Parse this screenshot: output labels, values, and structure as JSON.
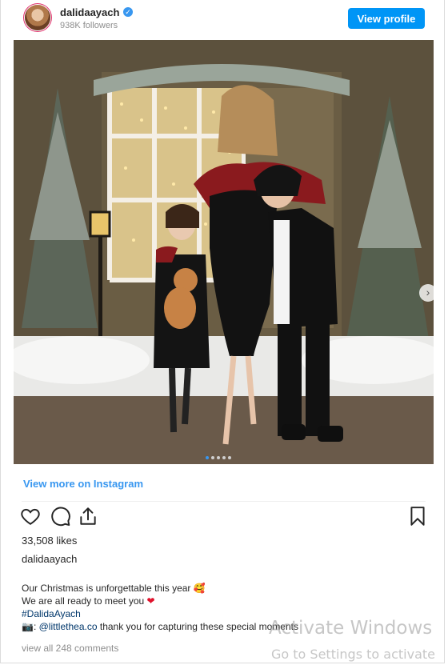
{
  "post": {
    "username": "dalidaayach",
    "verified_mark": "✓",
    "followers": "938K followers",
    "view_profile": "View profile",
    "view_more": "View more on Instagram",
    "likes": "33,508 likes",
    "owner": "dalidaayach",
    "caption": {
      "line1": "Our Christmas is unforgettable this year",
      "line1_emoji": "🥰",
      "line2": "We are all ready to meet you",
      "line2_emoji": "❤",
      "hashtag": "#DalidaAyach",
      "line4_icon": "📷:",
      "mention": "@littlethea.co",
      "line4_text": "thank you for capturing these special moments"
    },
    "comments_link": "view all 248 comments",
    "carousel_next": "›",
    "photo_subject": "family-christmas-photo"
  },
  "watermark": {
    "line1": "Activate Windows",
    "line2": "Go to Settings to activate"
  },
  "colors": {
    "accent": "#0095f6",
    "link": "#3897f0",
    "hashtag": "#00376b",
    "heart": "#e0112b"
  },
  "icons": [
    "heart-icon",
    "comment-icon",
    "share-icon",
    "bookmark-icon",
    "verified-badge-icon"
  ]
}
